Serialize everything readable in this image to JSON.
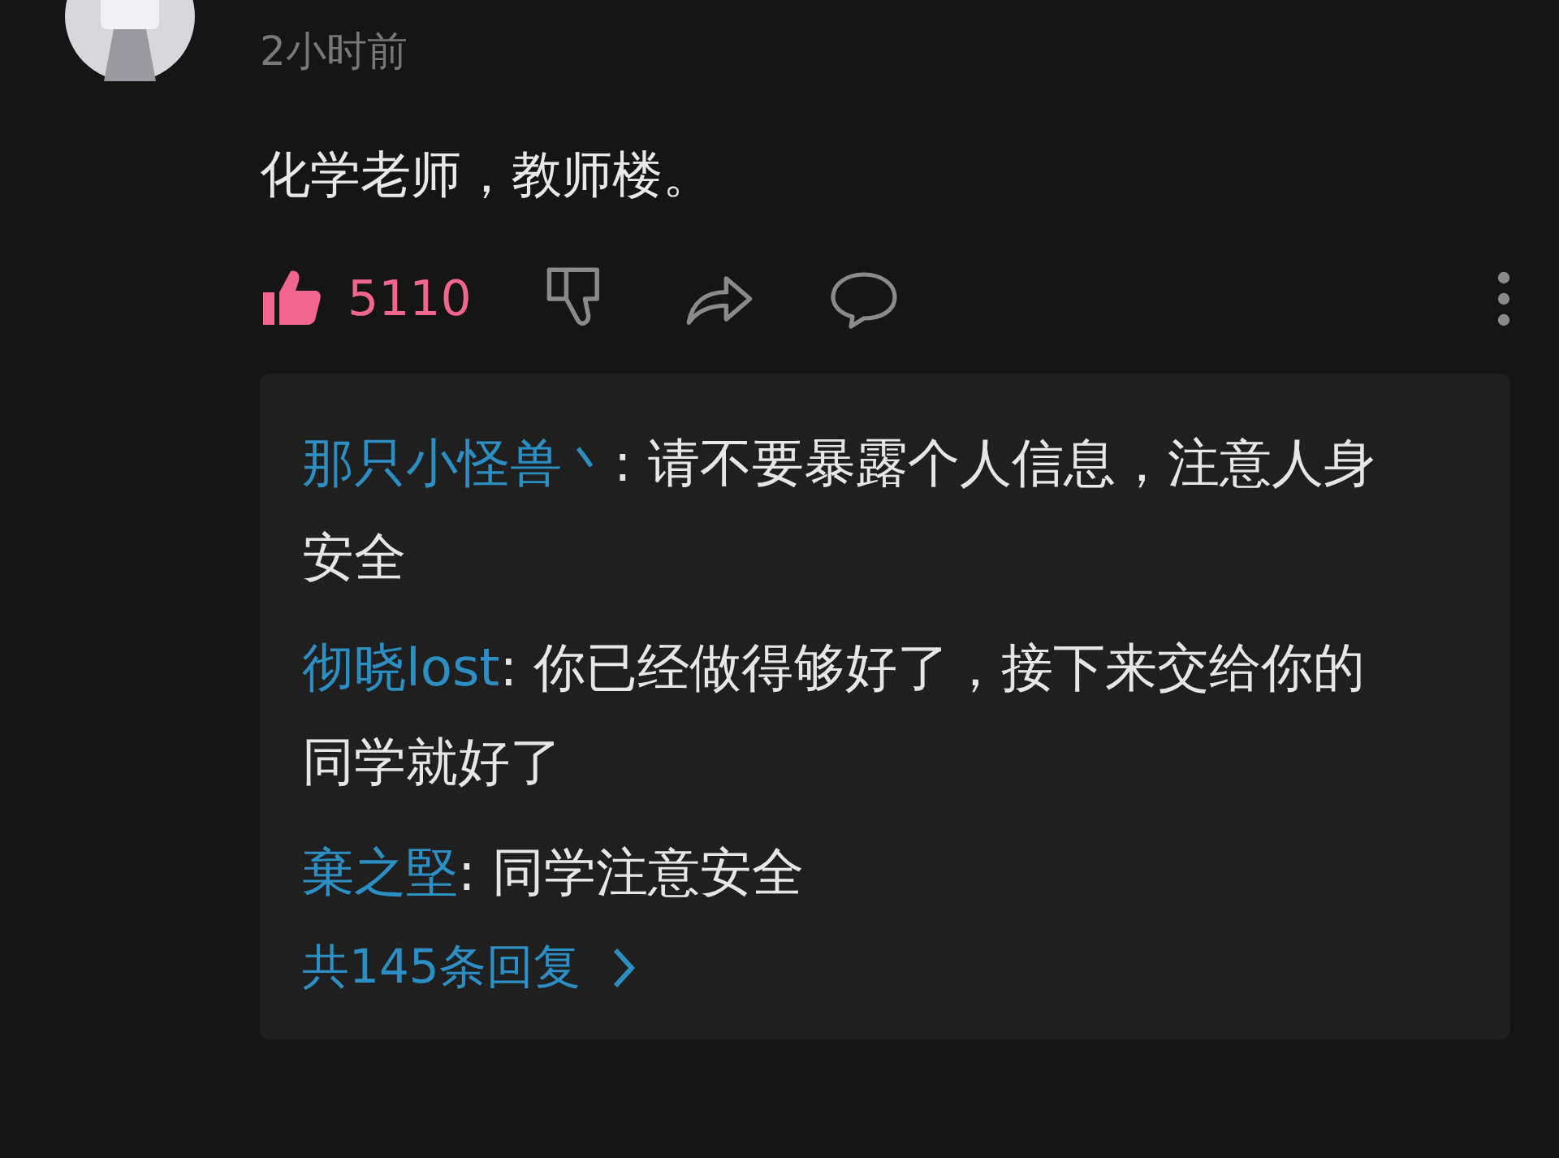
{
  "comment": {
    "time": "2小时前",
    "text": "化学老师，教师楼。",
    "likes": "5110",
    "liked": true
  },
  "replies": [
    {
      "author": "那只小怪兽丶",
      "text": ": 请不要暴露个人信息，注意人身安全"
    },
    {
      "author": "彻晓lost",
      "text": ": 你已经做得够好了，接下来交给你的同学就好了"
    },
    {
      "author": "棄之堅",
      "text": ": 同学注意安全"
    }
  ],
  "more_replies": "共145条回复"
}
